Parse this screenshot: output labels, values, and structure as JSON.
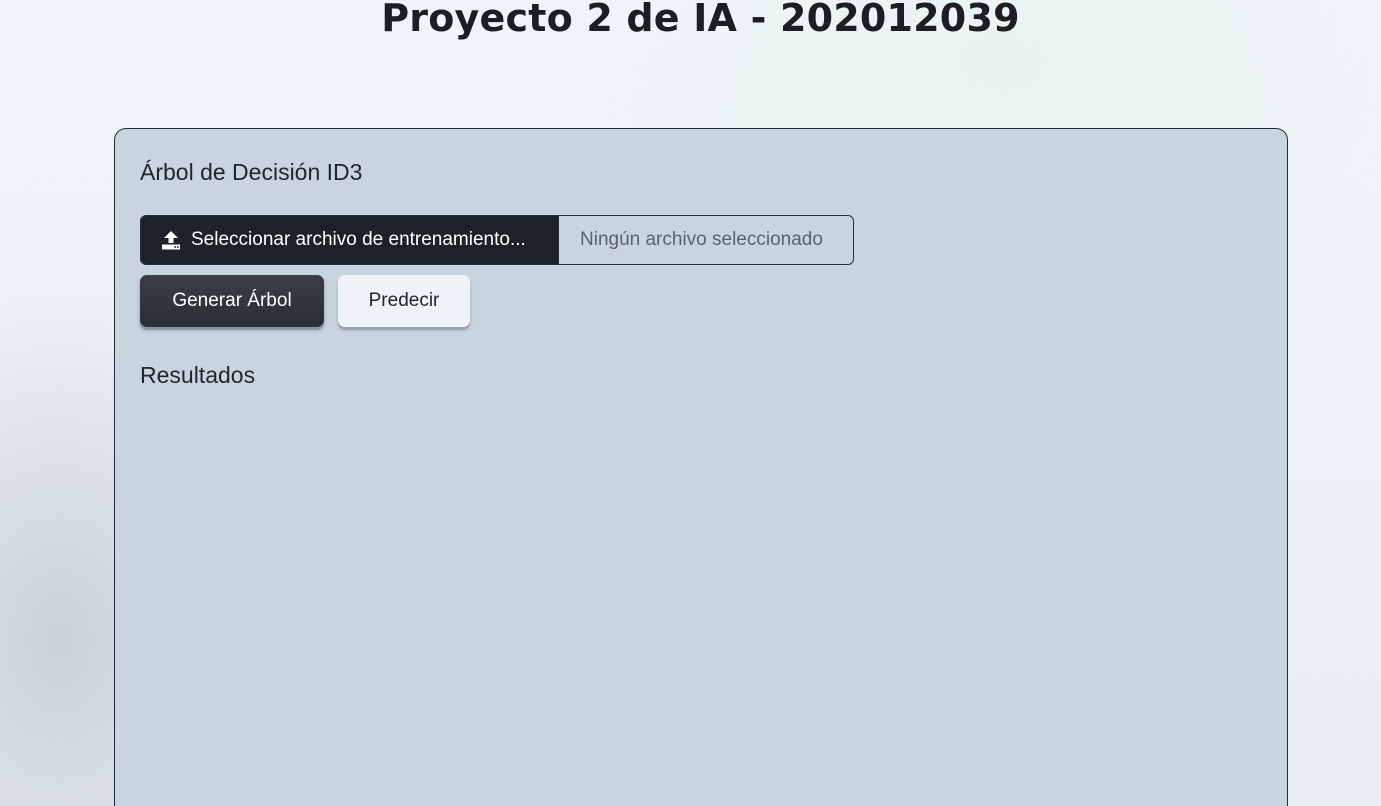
{
  "header": {
    "title": "Proyecto 2 de IA - 202012039"
  },
  "panel": {
    "title": "Árbol de Decisión ID3",
    "file_input": {
      "button_label": "Seleccionar archivo de entrenamiento...",
      "status_text": "Ningún archivo seleccionado",
      "icon": "upload-icon"
    },
    "actions": {
      "generate_label": "Generar Árbol",
      "predict_label": "Predecir"
    },
    "results": {
      "title": "Resultados"
    }
  },
  "colors": {
    "panel_background": "#c8d5df",
    "dark_button": "#1e2129",
    "light_button": "#eff3f7"
  }
}
